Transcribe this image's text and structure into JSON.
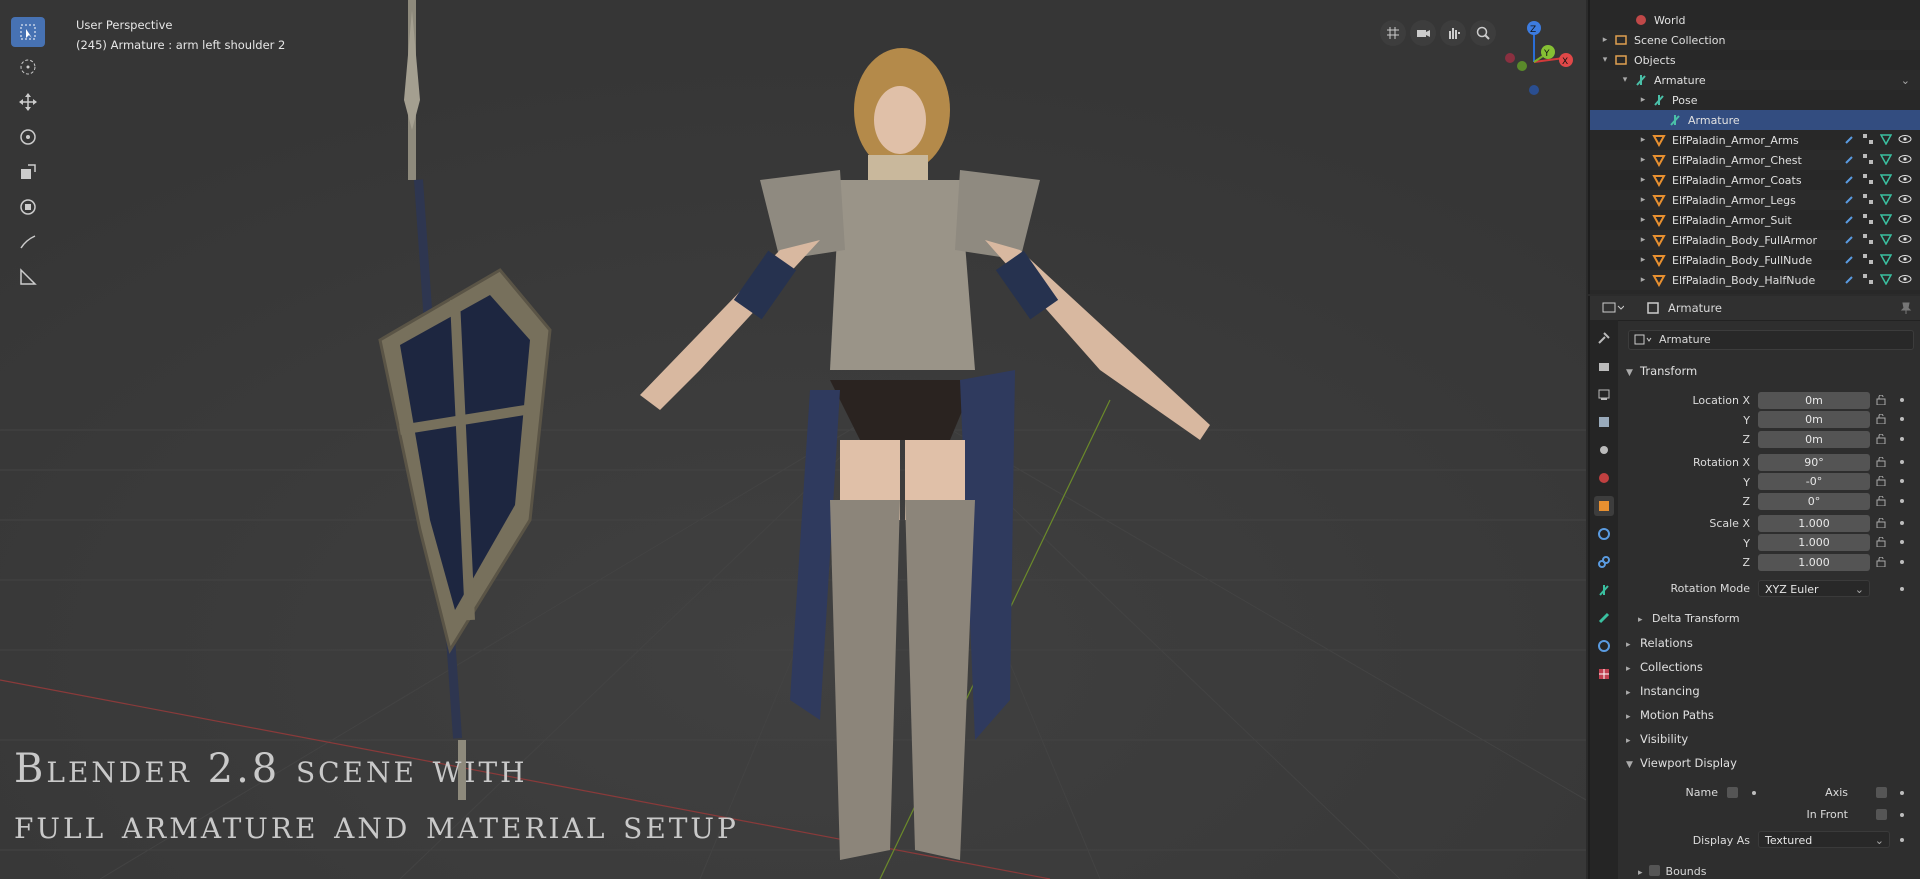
{
  "viewport": {
    "view_name": "User Perspective",
    "active_info": "(245) Armature : arm left shoulder 2",
    "caption_line1": "Blender 2.8 scene with",
    "caption_line2": "full armature and material setup",
    "tools": [
      "select-box-icon",
      "cursor-icon",
      "move-icon",
      "rotate-icon",
      "scale-icon",
      "transform-icon",
      "annotate-icon",
      "measure-icon"
    ],
    "gizmo": {
      "z": "Z",
      "y": "Y",
      "x": "X"
    }
  },
  "outliner": {
    "rows": [
      {
        "label": "World",
        "icon": "world-icon",
        "indent": 0
      },
      {
        "label": "Scene Collection",
        "icon": "collection-icon",
        "indent": 1
      },
      {
        "label": "Objects",
        "icon": "collection-icon",
        "indent": 1
      },
      {
        "label": "Armature",
        "icon": "armature-icon",
        "indent": 2
      },
      {
        "label": "Pose",
        "icon": "pose-icon",
        "indent": 3
      },
      {
        "label": "Armature",
        "icon": "armature-data-icon",
        "indent": 3
      },
      {
        "label": "ElfPaladin_Armor_Arms",
        "icon": "mesh-icon",
        "indent": 3
      },
      {
        "label": "ElfPaladin_Armor_Chest",
        "icon": "mesh-icon",
        "indent": 3
      },
      {
        "label": "ElfPaladin_Armor_Coats",
        "icon": "mesh-icon",
        "indent": 3
      },
      {
        "label": "ElfPaladin_Armor_Legs",
        "icon": "mesh-icon",
        "indent": 3
      },
      {
        "label": "ElfPaladin_Armor_Suit",
        "icon": "mesh-icon",
        "indent": 3
      },
      {
        "label": "ElfPaladin_Body_FullArmor",
        "icon": "mesh-icon",
        "indent": 3
      },
      {
        "label": "ElfPaladin_Body_FullNude",
        "icon": "mesh-icon",
        "indent": 3
      },
      {
        "label": "ElfPaladin_Body_HalfNude",
        "icon": "mesh-icon",
        "indent": 3
      }
    ]
  },
  "properties": {
    "header_title": "Armature",
    "object_name": "Armature",
    "transform_label": "Transform",
    "location_x_label": "Location X",
    "y_label": "Y",
    "z_label": "Z",
    "rotation_x_label": "Rotation X",
    "scale_x_label": "Scale X",
    "location": [
      "0m",
      "0m",
      "0m"
    ],
    "rotation": [
      "90°",
      "-0°",
      "0°"
    ],
    "scale": [
      "1.000",
      "1.000",
      "1.000"
    ],
    "rotation_mode_label": "Rotation Mode",
    "rotation_mode": "XYZ Euler",
    "delta_transform": "Delta Transform",
    "sections": [
      "Relations",
      "Collections",
      "Instancing",
      "Motion Paths",
      "Visibility"
    ],
    "viewport_display": "Viewport Display",
    "name_label": "Name",
    "axis_label": "Axis",
    "in_front_label": "In Front",
    "display_as_label": "Display As",
    "display_as": "Textured",
    "bounds_label": "Bounds"
  }
}
